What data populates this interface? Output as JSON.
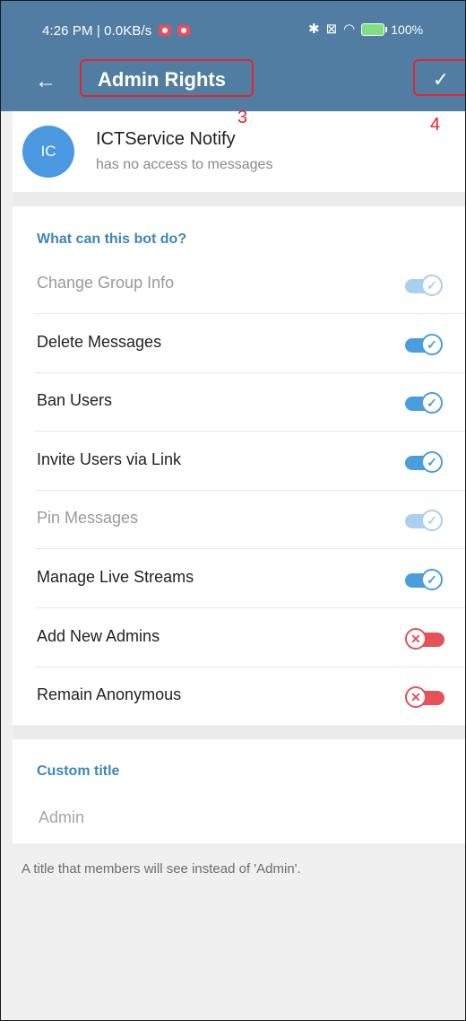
{
  "status_bar": {
    "time": "4:26 PM | 0.0KB/s",
    "battery": "100"
  },
  "app_bar": {
    "title": "Admin Rights",
    "back_icon": "arrow-left-icon",
    "confirm_icon": "check-icon"
  },
  "annotations": {
    "title_marker": "3",
    "confirm_marker": "4",
    "color": "#e5242b"
  },
  "bot": {
    "initials": "IC",
    "name": "ICTService Notify",
    "status": "has no access to messages",
    "avatar_color": "#4a99e0"
  },
  "rights": {
    "header": "What can this bot do?",
    "items": [
      {
        "label": "Change Group Info",
        "enabled": true,
        "editable": false
      },
      {
        "label": "Delete Messages",
        "enabled": true,
        "editable": true
      },
      {
        "label": "Ban Users",
        "enabled": true,
        "editable": true
      },
      {
        "label": "Invite Users via Link",
        "enabled": true,
        "editable": true
      },
      {
        "label": "Pin Messages",
        "enabled": true,
        "editable": false
      },
      {
        "label": "Manage Live Streams",
        "enabled": true,
        "editable": true
      },
      {
        "label": "Add New Admins",
        "enabled": false,
        "editable": true
      },
      {
        "label": "Remain Anonymous",
        "enabled": false,
        "editable": true
      }
    ]
  },
  "custom_title": {
    "header": "Custom title",
    "placeholder": "Admin",
    "value": "",
    "hint": "A title that members will see instead of 'Admin'."
  },
  "colors": {
    "header_bg": "#517da2",
    "accent": "#3e86b8",
    "toggle_on": "#4b9edd",
    "toggle_off": "#e55258"
  }
}
